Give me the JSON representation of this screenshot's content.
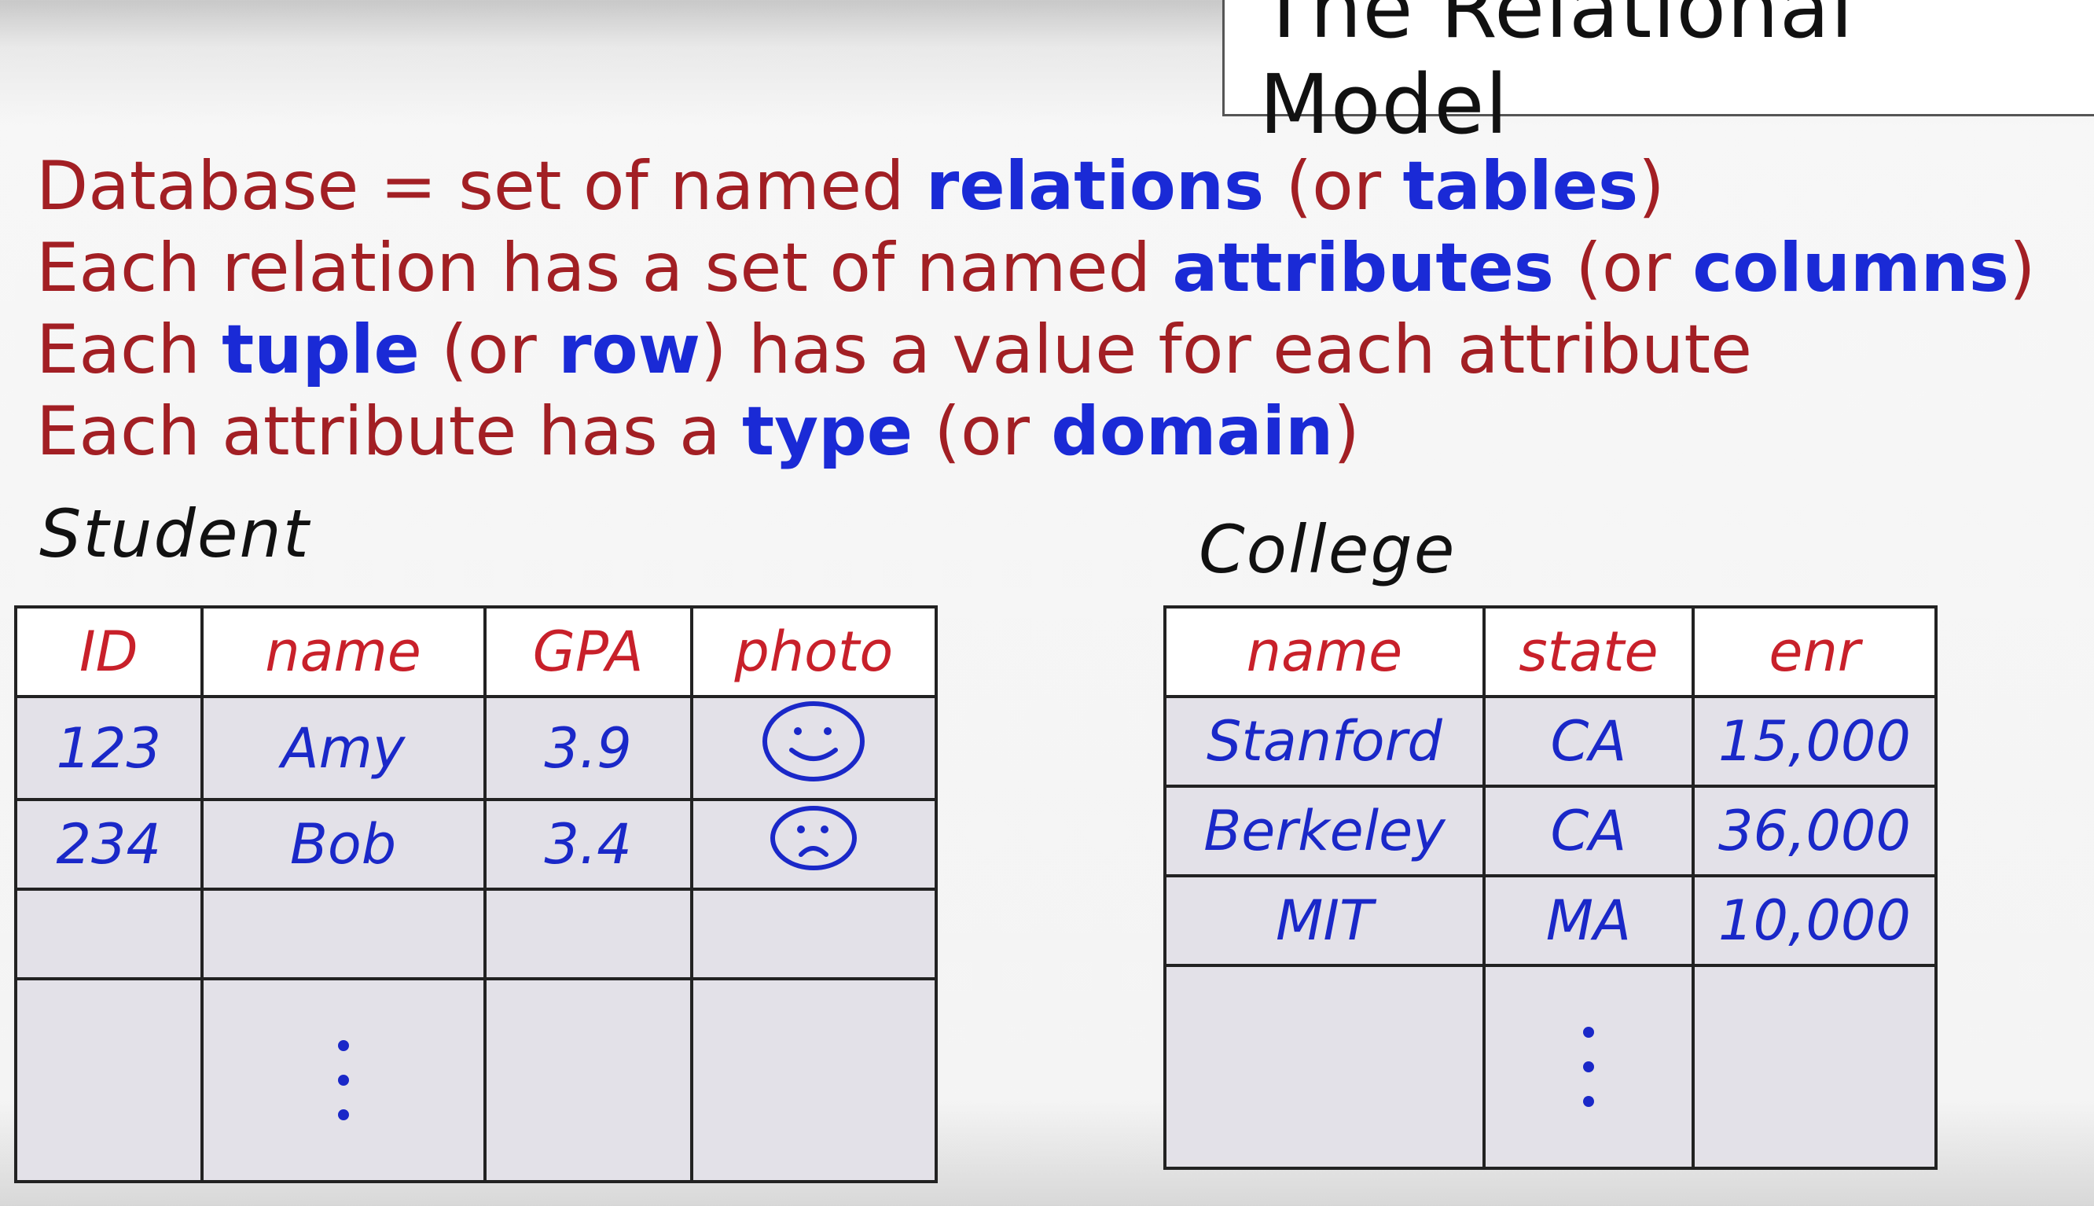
{
  "title": "The Relational Model",
  "bullets": [
    {
      "parts": [
        {
          "t": "Database = set of named ",
          "kw": false
        },
        {
          "t": "relations",
          "kw": true
        },
        {
          "t": " (or ",
          "kw": false
        },
        {
          "t": "tables",
          "kw": true
        },
        {
          "t": ")",
          "kw": false
        }
      ]
    },
    {
      "parts": [
        {
          "t": "Each relation has a set of named ",
          "kw": false
        },
        {
          "t": "attributes",
          "kw": true
        },
        {
          "t": " (or ",
          "kw": false
        },
        {
          "t": "columns",
          "kw": true
        },
        {
          "t": ")",
          "kw": false
        }
      ]
    },
    {
      "parts": [
        {
          "t": "Each ",
          "kw": false
        },
        {
          "t": "tuple",
          "kw": true
        },
        {
          "t": " (or ",
          "kw": false
        },
        {
          "t": "row",
          "kw": true
        },
        {
          "t": ") has a value for each attribute",
          "kw": false
        }
      ]
    },
    {
      "parts": [
        {
          "t": "Each attribute has a ",
          "kw": false
        },
        {
          "t": "type",
          "kw": true
        },
        {
          "t": " (or ",
          "kw": false
        },
        {
          "t": "domain",
          "kw": true
        },
        {
          "t": ")",
          "kw": false
        }
      ]
    }
  ],
  "student": {
    "name": "Student",
    "columns": [
      "ID",
      "name",
      "GPA",
      "photo"
    ],
    "rows": [
      {
        "id": "123",
        "name": "Amy",
        "gpa": "3.9",
        "photo_icon": "smiley-face-icon"
      },
      {
        "id": "234",
        "name": "Bob",
        "gpa": "3.4",
        "photo_icon": "sad-face-icon"
      }
    ]
  },
  "college": {
    "name": "College",
    "columns": [
      "name",
      "state",
      "enr"
    ],
    "rows": [
      [
        "Stanford",
        "CA",
        "15,000"
      ],
      [
        "Berkeley",
        "CA",
        "36,000"
      ],
      [
        "MIT",
        "MA",
        "10,000"
      ]
    ]
  },
  "colors": {
    "text_red": "#a21f24",
    "keyword_blue": "#1a2ad6",
    "ink_red": "#c8202a",
    "ink_blue": "#1a28c8"
  }
}
